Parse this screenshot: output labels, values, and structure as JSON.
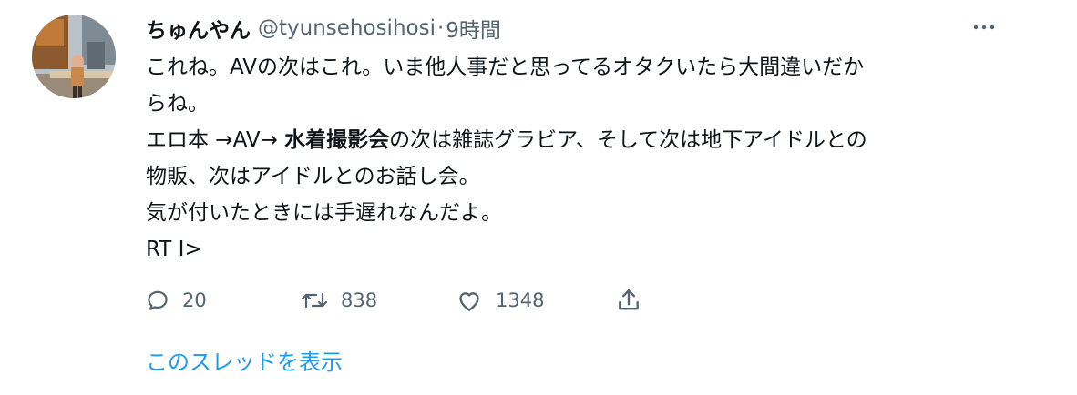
{
  "tweet": {
    "display_name": "ちゅんやん",
    "handle": "@tyunsehosihosi",
    "separator": "·",
    "time": "9時間",
    "more_icon": "more-horizontal-icon",
    "body": {
      "line1": "これね。AVの次はこれ。いま他人事だと思ってるオタクいたら大間違いだか",
      "line2": "らね。",
      "line3_prefix": "エロ本 →AV→ ",
      "line3_bold": "水着撮影会",
      "line3_suffix": "の次は雑誌グラビア、そして次は地下アイドルとの",
      "line4": "物販、次はアイドルとのお話し会。",
      "line5": "気が付いたときには手遅れなんだよ。",
      "line6": "RT I>"
    },
    "actions": {
      "reply_count": "20",
      "retweet_count": "838",
      "like_count": "1348",
      "reply_icon": "reply-icon",
      "retweet_icon": "retweet-icon",
      "like_icon": "heart-icon",
      "share_icon": "share-icon"
    },
    "thread_link": "このスレッドを表示"
  },
  "colors": {
    "text_primary": "#0f1419",
    "text_secondary": "#536471",
    "link": "#1d9bf0"
  }
}
